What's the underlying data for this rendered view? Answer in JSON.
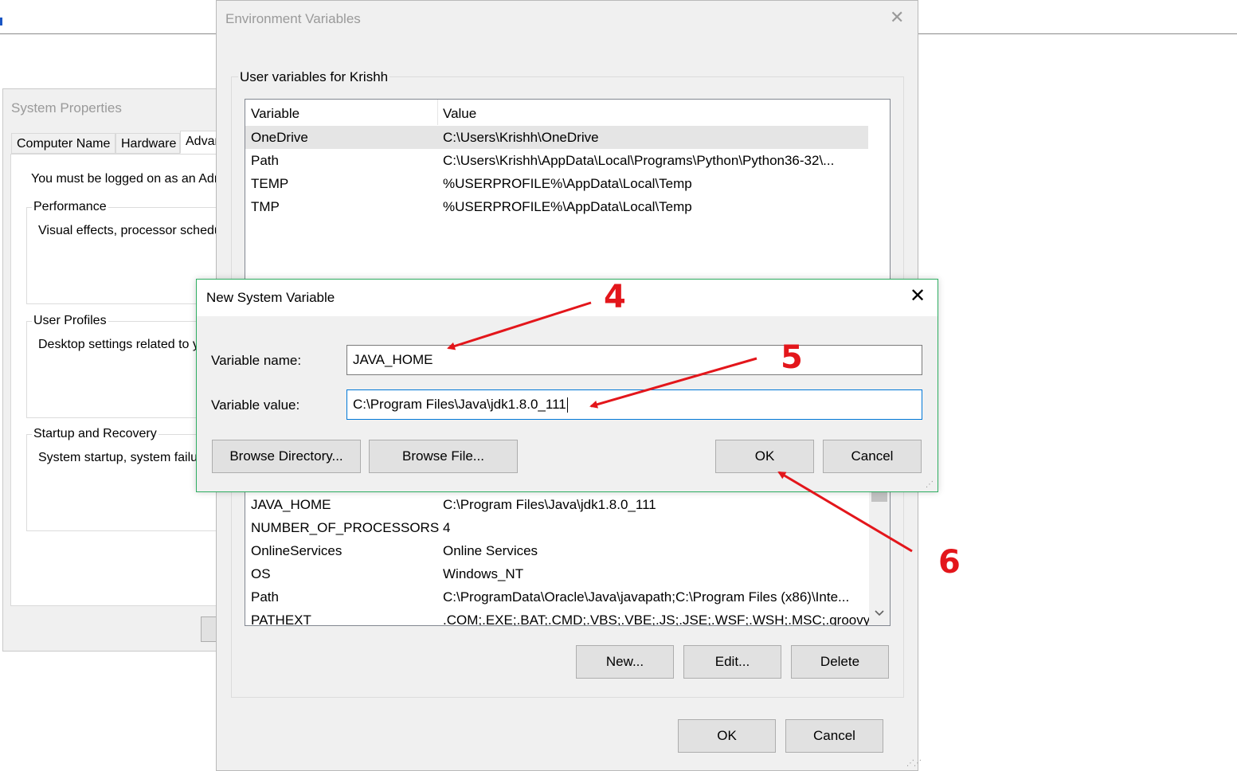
{
  "system_properties": {
    "title": "System Properties",
    "tabs": [
      "Computer Name",
      "Hardware",
      "Advan"
    ],
    "admin_note": "You must be logged on as an Adr",
    "performance": {
      "label": "Performance",
      "description": "Visual effects, processor schedu"
    },
    "user_profiles": {
      "label": "User Profiles",
      "description": "Desktop settings related to y"
    },
    "startup_recovery": {
      "label": "Startup and Recovery",
      "description": "System startup, system failu"
    }
  },
  "env_window": {
    "title": "Environment Variables",
    "user_section_label": "User variables for Krishh",
    "user_columns": {
      "variable": "Variable",
      "value": "Value"
    },
    "user_vars": [
      {
        "name": "OneDrive",
        "value": "C:\\Users\\Krishh\\OneDrive"
      },
      {
        "name": "Path",
        "value": "C:\\Users\\Krishh\\AppData\\Local\\Programs\\Python\\Python36-32\\..."
      },
      {
        "name": "TEMP",
        "value": "%USERPROFILE%\\AppData\\Local\\Temp"
      },
      {
        "name": "TMP",
        "value": "%USERPROFILE%\\AppData\\Local\\Temp"
      }
    ],
    "system_vars": [
      {
        "name": "JAVA_HOME",
        "value": "C:\\Program Files\\Java\\jdk1.8.0_111"
      },
      {
        "name": "NUMBER_OF_PROCESSORS",
        "value": "4"
      },
      {
        "name": "OnlineServices",
        "value": "Online Services"
      },
      {
        "name": "OS",
        "value": "Windows_NT"
      },
      {
        "name": "Path",
        "value": "C:\\ProgramData\\Oracle\\Java\\javapath;C:\\Program Files (x86)\\Inte..."
      },
      {
        "name": "PATHEXT",
        "value": ".COM;.EXE;.BAT;.CMD;.VBS;.VBE;.JS;.JSE;.WSF;.WSH;.MSC;.groovy;..."
      }
    ],
    "system_buttons": {
      "new": "New...",
      "edit": "Edit...",
      "delete": "Delete"
    },
    "footer_buttons": {
      "ok": "OK",
      "cancel": "Cancel"
    },
    "close_glyph": "✕"
  },
  "new_var_dialog": {
    "title": "New System Variable",
    "close_glyph": "✕",
    "name_label": "Variable name:",
    "name_value": "JAVA_HOME",
    "value_label": "Variable value:",
    "value_value": "C:\\Program Files\\Java\\jdk1.8.0_111",
    "buttons": {
      "browse_directory": "Browse Directory...",
      "browse_file": "Browse File...",
      "ok": "OK",
      "cancel": "Cancel"
    }
  },
  "annotations": {
    "step4": "4",
    "step5": "5",
    "step6": "6"
  },
  "colors": {
    "annotation_red": "#e3161b",
    "dialog_border_green": "#2fae62",
    "focus_blue": "#0078d7"
  },
  "icons": {
    "scroll_down": "chevron-down-icon",
    "scroll_up": "chevron-up-icon",
    "resize": "size-grip-icon"
  }
}
